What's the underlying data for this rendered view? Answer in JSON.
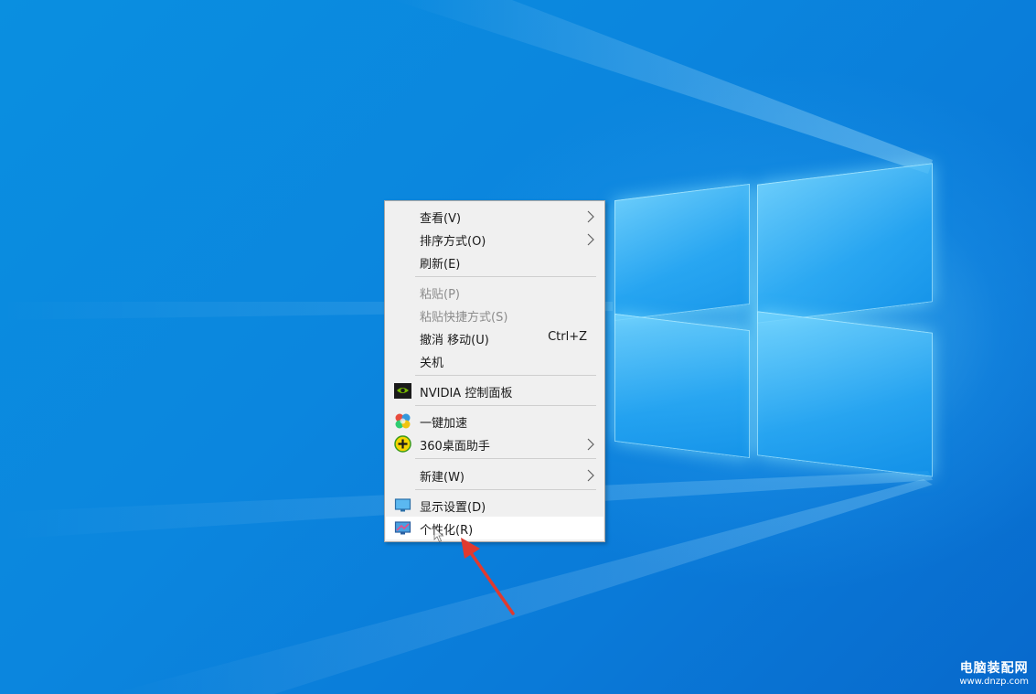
{
  "desktop": {
    "wallpaper": "windows-10-hero",
    "colors": {
      "background": "#0a86de",
      "menu_bg": "#f0f0f0",
      "menu_highlight": "#ffffff",
      "arrow": "#e03a2f"
    }
  },
  "context_menu": {
    "items": [
      {
        "label": "查看(V)",
        "has_submenu": true
      },
      {
        "label": "排序方式(O)",
        "has_submenu": true
      },
      {
        "label": "刷新(E)"
      },
      {
        "label": "粘贴(P)",
        "disabled": true
      },
      {
        "label": "粘贴快捷方式(S)",
        "disabled": true
      },
      {
        "label": "撤消 移动(U)",
        "shortcut": "Ctrl+Z"
      },
      {
        "label": "关机"
      },
      {
        "label": "NVIDIA 控制面板",
        "icon": "nvidia-icon"
      },
      {
        "label": "一键加速",
        "icon": "speedup-icon"
      },
      {
        "label": "360桌面助手",
        "icon": "360-desktop-icon",
        "has_submenu": true
      },
      {
        "label": "新建(W)",
        "has_submenu": true
      },
      {
        "label": "显示设置(D)",
        "icon": "display-settings-icon"
      },
      {
        "label": "个性化(R)",
        "icon": "personalize-icon",
        "highlighted": true
      }
    ]
  },
  "watermark": {
    "main": "电脑装配网",
    "sub": "www.dnzp.com"
  }
}
